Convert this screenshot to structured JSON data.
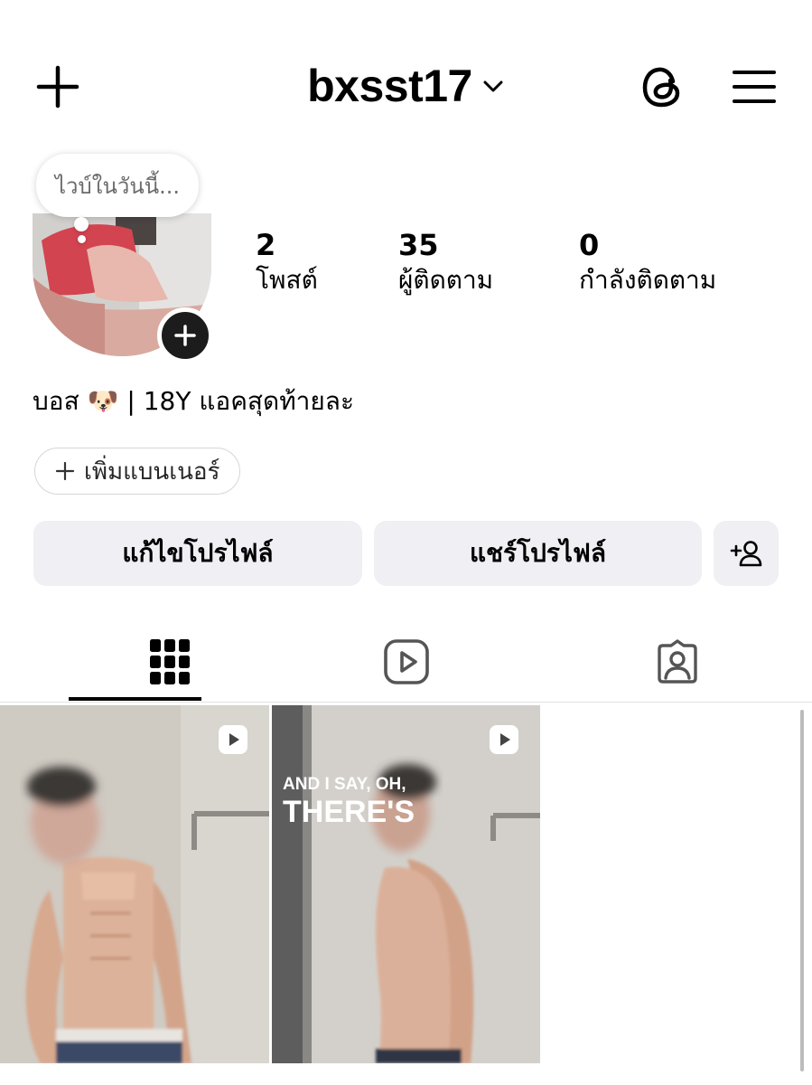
{
  "header": {
    "username": "bxsst17",
    "icons": [
      "plus-icon",
      "chevron-down-icon",
      "threads-icon",
      "hamburger-menu-icon"
    ]
  },
  "note": {
    "text": "ไวบ์ในวันนี้..."
  },
  "stats": [
    {
      "count": "2",
      "label": "โพสต์"
    },
    {
      "count": "35",
      "label": "ผู้ติดตาม"
    },
    {
      "count": "0",
      "label": "กำลังติดตาม"
    }
  ],
  "bio": {
    "name": "บอส",
    "emoji": "🐶",
    "text": "| 18Y แอคสุดท้ายละ"
  },
  "banner": {
    "label": "เพิ่มแบนเนอร์"
  },
  "actions": {
    "edit_profile": "แก้ไขโปรไฟล์",
    "share_profile": "แชร์โปรไฟล์"
  },
  "tabs": [
    {
      "icon": "grid-icon",
      "active": true
    },
    {
      "icon": "reels-icon",
      "active": false
    },
    {
      "icon": "tagged-icon",
      "active": false
    }
  ],
  "posts": [
    {
      "type": "reel",
      "caption_line1": "",
      "caption_line2": ""
    },
    {
      "type": "reel",
      "caption_line1": "AND I SAY, OH,",
      "caption_line2": "THERE'S"
    }
  ]
}
